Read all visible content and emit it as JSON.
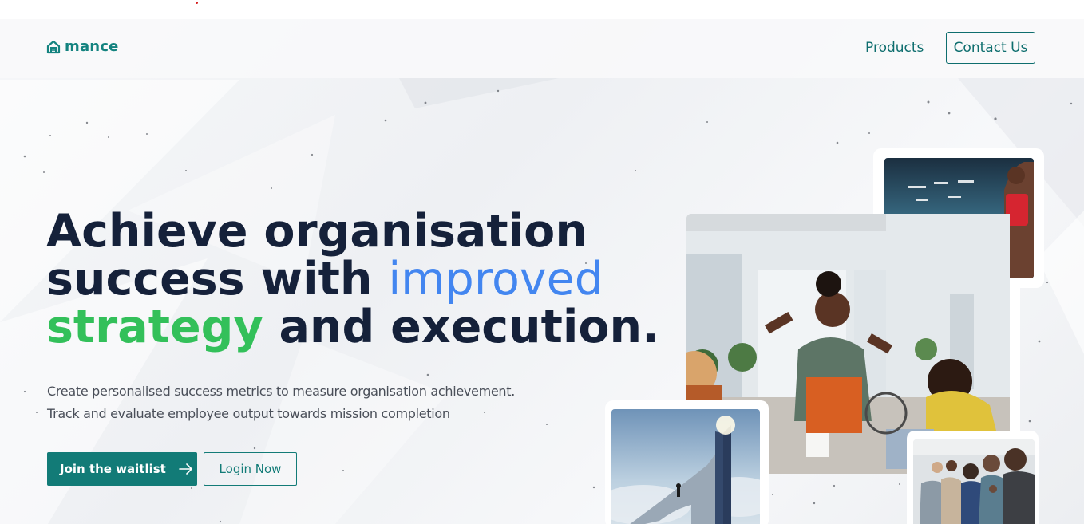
{
  "brand": {
    "name": "mance",
    "logo_icon": "house-icon",
    "color": "#14837f"
  },
  "nav": {
    "products_label": "Products",
    "contact_label": "Contact Us"
  },
  "hero": {
    "headline": {
      "line1": "Achieve organisation",
      "line2_prefix": "success with ",
      "line2_highlight": "improved",
      "line3_highlight": "strategy",
      "line3_suffix": " and execution."
    },
    "subtext": [
      "Create personalised success metrics to measure organisation achievement.",
      "Track and evaluate employee output towards mission completion"
    ],
    "primary_cta": {
      "label": "Join the waitlist",
      "icon": "arrow-right-icon"
    },
    "secondary_cta": {
      "label": "Login Now"
    }
  },
  "colors": {
    "teal": "#127b77",
    "navy": "#15213a",
    "blue": "#4386f0",
    "green": "#33c05a"
  },
  "images": [
    {
      "name": "runner-finish-photo"
    },
    {
      "name": "office-celebration-photo"
    },
    {
      "name": "climber-stairs-photo"
    },
    {
      "name": "audience-clapping-photo"
    }
  ]
}
